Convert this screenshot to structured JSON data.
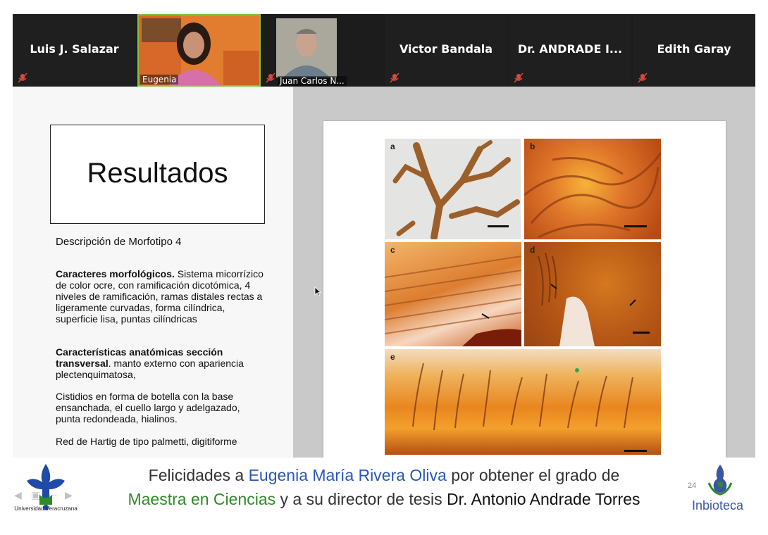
{
  "participants": [
    {
      "name": "Luis J. Salazar",
      "muted": true
    },
    {
      "name": "Eugenia",
      "muted": false,
      "video": true
    },
    {
      "name": "Juan Carlos N...",
      "muted": true,
      "video": true
    },
    {
      "name": "Victor Bandala",
      "muted": true
    },
    {
      "name": "Dr. ANDRADE I...",
      "muted": true
    },
    {
      "name": "Edith Garay",
      "muted": true
    }
  ],
  "slide": {
    "title": "Resultados",
    "subtitle": "Descripción de Morfotipo 4",
    "morph_heading": "Caracteres morfológicos.",
    "morph_text": " Sistema micorrízico de color ocre, con ramificación dicotómica, 4 niveles de ramificación, ramas distales rectas a ligeramente curvadas, forma cilíndrica, superficie lisa, puntas cilíndricas",
    "anat_heading": "Características anatómicas sección transversal",
    "anat_text": ". manto externo con apariencia plectenquimatosa,",
    "cystidia_text": "Cistidios en forma de botella con la base ensanchada, el cuello largo y adelgazado, punta redondeada, hialinos.",
    "hartig_text": "Red de Hartig de tipo palmetti, digitiforme",
    "panel_labels": [
      "a",
      "b",
      "c",
      "d",
      "e"
    ],
    "page_number": "24"
  },
  "banner": {
    "line1_part1": "Felicidades a ",
    "line1_name": "Eugenia María Rivera Oliva",
    "line1_part2": " por obtener el grado de",
    "line2_degree": "Maestra en Ciencias",
    "line2_part1": " y a su director de tesis ",
    "line2_director": "Dr. Antonio Andrade Torres",
    "left_logo_caption": "Universidad Veracruzana",
    "right_logo_caption": "Inbioteca"
  },
  "colors": {
    "strip_bg": "#1c1c1c",
    "active_speaker_border": "#7fc241",
    "muted_icon": "#e0443e",
    "banner_blue": "#2a57b7",
    "banner_green": "#2e8b28"
  },
  "icons": {
    "muted": "mic-off-icon",
    "nav_prev": "arrow-left-icon",
    "nav_next": "arrow-right-icon"
  }
}
